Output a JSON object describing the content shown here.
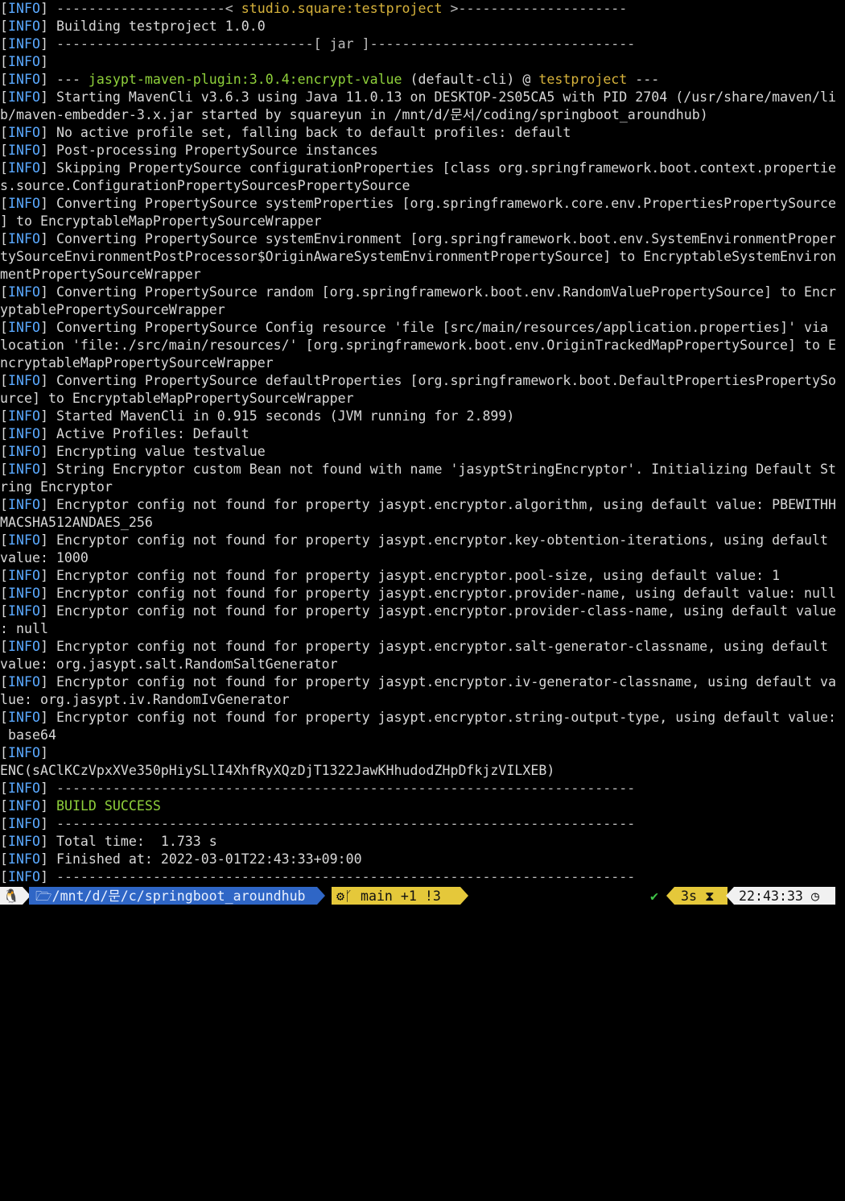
{
  "terminal": {
    "lines": [
      {
        "prefix": "[INFO]",
        "parts": [
          {
            "t": " ---------------------< ",
            "c": "dim"
          },
          {
            "t": "studio.square:testproject",
            "c": "yel"
          },
          {
            "t": " >---------------------",
            "c": "dim"
          }
        ]
      },
      {
        "prefix": "[INFO]",
        "parts": [
          {
            "t": " Building testproject 1.0.0",
            "c": ""
          }
        ]
      },
      {
        "prefix": "[INFO]",
        "parts": [
          {
            "t": " --------------------------------[ jar ]---------------------------------",
            "c": "dim"
          }
        ]
      },
      {
        "prefix": "[INFO]",
        "parts": []
      },
      {
        "prefix": "[INFO]",
        "parts": [
          {
            "t": " --- ",
            "c": ""
          },
          {
            "t": "jasypt-maven-plugin:3.0.4:encrypt-value",
            "c": "grn"
          },
          {
            "t": " (default-cli) @ ",
            "c": ""
          },
          {
            "t": "testproject",
            "c": "yel"
          },
          {
            "t": " ---",
            "c": ""
          }
        ]
      },
      {
        "prefix": "[INFO]",
        "parts": [
          {
            "t": " Starting MavenCli v3.6.3 using Java 11.0.13 on DESKTOP-2S05CA5 with PID 2704 (/usr/share/maven/li",
            "c": ""
          }
        ]
      },
      {
        "prefix": "",
        "parts": [
          {
            "t": "b/maven-embedder-3.x.jar started by squareyun in /mnt/d/문서/coding/springboot_aroundhub)",
            "c": ""
          }
        ]
      },
      {
        "prefix": "[INFO]",
        "parts": [
          {
            "t": " No active profile set, falling back to default profiles: default",
            "c": ""
          }
        ]
      },
      {
        "prefix": "[INFO]",
        "parts": [
          {
            "t": " Post-processing PropertySource instances",
            "c": ""
          }
        ]
      },
      {
        "prefix": "[INFO]",
        "parts": [
          {
            "t": " Skipping PropertySource configurationProperties [class org.springframework.boot.context.propertie",
            "c": ""
          }
        ]
      },
      {
        "prefix": "",
        "parts": [
          {
            "t": "s.source.ConfigurationPropertySourcesPropertySource",
            "c": ""
          }
        ]
      },
      {
        "prefix": "[INFO]",
        "parts": [
          {
            "t": " Converting PropertySource systemProperties [org.springframework.core.env.PropertiesPropertySource",
            "c": ""
          }
        ]
      },
      {
        "prefix": "",
        "parts": [
          {
            "t": "] to EncryptableMapPropertySourceWrapper",
            "c": ""
          }
        ]
      },
      {
        "prefix": "[INFO]",
        "parts": [
          {
            "t": " Converting PropertySource systemEnvironment [org.springframework.boot.env.SystemEnvironmentProper",
            "c": ""
          }
        ]
      },
      {
        "prefix": "",
        "parts": [
          {
            "t": "tySourceEnvironmentPostProcessor$OriginAwareSystemEnvironmentPropertySource] to EncryptableSystemEnviron",
            "c": ""
          }
        ]
      },
      {
        "prefix": "",
        "parts": [
          {
            "t": "mentPropertySourceWrapper",
            "c": ""
          }
        ]
      },
      {
        "prefix": "[INFO]",
        "parts": [
          {
            "t": " Converting PropertySource random [org.springframework.boot.env.RandomValuePropertySource] to Encr",
            "c": ""
          }
        ]
      },
      {
        "prefix": "",
        "parts": [
          {
            "t": "yptablePropertySourceWrapper",
            "c": ""
          }
        ]
      },
      {
        "prefix": "[INFO]",
        "parts": [
          {
            "t": " Converting PropertySource Config resource 'file [src/main/resources/application.properties]' via",
            "c": ""
          }
        ]
      },
      {
        "prefix": "",
        "parts": [
          {
            "t": "location 'file:./src/main/resources/' [org.springframework.boot.env.OriginTrackedMapPropertySource] to E",
            "c": ""
          }
        ]
      },
      {
        "prefix": "",
        "parts": [
          {
            "t": "ncryptableMapPropertySourceWrapper",
            "c": ""
          }
        ]
      },
      {
        "prefix": "[INFO]",
        "parts": [
          {
            "t": " Converting PropertySource defaultProperties [org.springframework.boot.DefaultPropertiesPropertySo",
            "c": ""
          }
        ]
      },
      {
        "prefix": "",
        "parts": [
          {
            "t": "urce] to EncryptableMapPropertySourceWrapper",
            "c": ""
          }
        ]
      },
      {
        "prefix": "[INFO]",
        "parts": [
          {
            "t": " Started MavenCli in 0.915 seconds (JVM running for 2.899)",
            "c": ""
          }
        ]
      },
      {
        "prefix": "[INFO]",
        "parts": [
          {
            "t": " Active Profiles: Default",
            "c": ""
          }
        ]
      },
      {
        "prefix": "[INFO]",
        "parts": [
          {
            "t": " Encrypting value testvalue",
            "c": ""
          }
        ]
      },
      {
        "prefix": "[INFO]",
        "parts": [
          {
            "t": " String Encryptor custom Bean not found with name 'jasyptStringEncryptor'. Initializing Default St",
            "c": ""
          }
        ]
      },
      {
        "prefix": "",
        "parts": [
          {
            "t": "ring Encryptor",
            "c": ""
          }
        ]
      },
      {
        "prefix": "[INFO]",
        "parts": [
          {
            "t": " Encryptor config not found for property jasypt.encryptor.algorithm, using default value: PBEWITHH",
            "c": ""
          }
        ]
      },
      {
        "prefix": "",
        "parts": [
          {
            "t": "MACSHA512ANDAES_256",
            "c": ""
          }
        ]
      },
      {
        "prefix": "[INFO]",
        "parts": [
          {
            "t": " Encryptor config not found for property jasypt.encryptor.key-obtention-iterations, using default",
            "c": ""
          }
        ]
      },
      {
        "prefix": "",
        "parts": [
          {
            "t": "value: 1000",
            "c": ""
          }
        ]
      },
      {
        "prefix": "[INFO]",
        "parts": [
          {
            "t": " Encryptor config not found for property jasypt.encryptor.pool-size, using default value: 1",
            "c": ""
          }
        ]
      },
      {
        "prefix": "[INFO]",
        "parts": [
          {
            "t": " Encryptor config not found for property jasypt.encryptor.provider-name, using default value: null",
            "c": ""
          }
        ]
      },
      {
        "prefix": "[INFO]",
        "parts": [
          {
            "t": " Encryptor config not found for property jasypt.encryptor.provider-class-name, using default value",
            "c": ""
          }
        ]
      },
      {
        "prefix": "",
        "parts": [
          {
            "t": ": null",
            "c": ""
          }
        ]
      },
      {
        "prefix": "[INFO]",
        "parts": [
          {
            "t": " Encryptor config not found for property jasypt.encryptor.salt-generator-classname, using default",
            "c": ""
          }
        ]
      },
      {
        "prefix": "",
        "parts": [
          {
            "t": "value: org.jasypt.salt.RandomSaltGenerator",
            "c": ""
          }
        ]
      },
      {
        "prefix": "[INFO]",
        "parts": [
          {
            "t": " Encryptor config not found for property jasypt.encryptor.iv-generator-classname, using default va",
            "c": ""
          }
        ]
      },
      {
        "prefix": "",
        "parts": [
          {
            "t": "lue: org.jasypt.iv.RandomIvGenerator",
            "c": ""
          }
        ]
      },
      {
        "prefix": "[INFO]",
        "parts": [
          {
            "t": " Encryptor config not found for property jasypt.encryptor.string-output-type, using default value:",
            "c": ""
          }
        ]
      },
      {
        "prefix": "",
        "parts": [
          {
            "t": " base64",
            "c": ""
          }
        ]
      },
      {
        "prefix": "[INFO]",
        "parts": []
      },
      {
        "prefix": "",
        "parts": [
          {
            "t": "ENC(sAClKCzVpxXVe350pHiySLlI4XhfRyXQzDjT1322JawKHhudodZHpDfkjzVILXEB)",
            "c": ""
          }
        ]
      },
      {
        "prefix": "[INFO]",
        "parts": [
          {
            "t": " ------------------------------------------------------------------------",
            "c": "dim"
          }
        ]
      },
      {
        "prefix": "[INFO]",
        "parts": [
          {
            "t": " ",
            "c": ""
          },
          {
            "t": "BUILD SUCCESS",
            "c": "grn"
          }
        ]
      },
      {
        "prefix": "[INFO]",
        "parts": [
          {
            "t": " ------------------------------------------------------------------------",
            "c": "dim"
          }
        ]
      },
      {
        "prefix": "[INFO]",
        "parts": [
          {
            "t": " Total time:  1.733 s",
            "c": ""
          }
        ]
      },
      {
        "prefix": "[INFO]",
        "parts": [
          {
            "t": " Finished at: 2022-03-01T22:43:33+09:00",
            "c": ""
          }
        ]
      },
      {
        "prefix": "[INFO]",
        "parts": [
          {
            "t": " ------------------------------------------------------------------------",
            "c": "dim"
          }
        ]
      }
    ]
  },
  "prompt": {
    "os_icon": "linux-tux-icon",
    "os_glyph": "🐧",
    "folder_glyph": "🗁",
    "path": "/mnt/d/문/c/springboot_aroundhub",
    "git_icon_glyph": "⚙",
    "branch_glyph": "ᚴ",
    "git_text": " main +1 !3",
    "status_check": "✔",
    "duration": "3s",
    "hourglass_glyph": "⧗",
    "clock_time": "22:43:33",
    "clock_glyph": "◷"
  },
  "colors": {
    "info": "#5aa9ff",
    "yellow": "#d6b23b",
    "green": "#8fd13b",
    "path_bg": "#2f66c6",
    "git_bg": "#e5c83a"
  }
}
